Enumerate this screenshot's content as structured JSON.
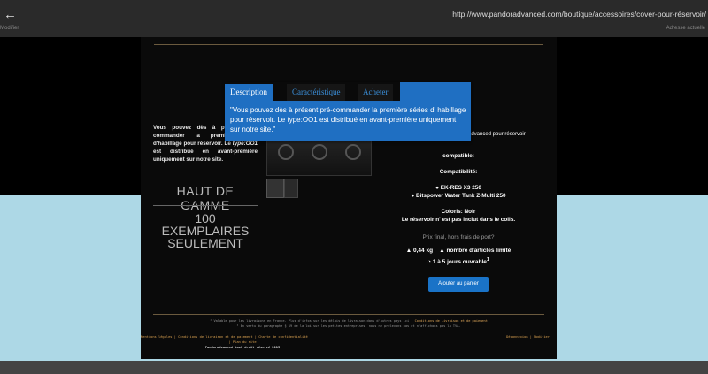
{
  "browser": {
    "back_label": "Modifier",
    "url": "http://www.pandoradvanced.com/boutique/accessoires/cover-pour-réservoir/",
    "address_label": "Adresse actuelle"
  },
  "intro": {
    "text_before": "Vous pouvez dès à présent pré-commander la première série d'habillage pour réservoir. Le ",
    "em": "type:OO1",
    "text_after": " est distribué en avant-première uniquement sur notre site."
  },
  "high_end": "HAUT DE GAMME",
  "limited_l1": "100 EXEMPLAIRES",
  "limited_l2": "SEULEMENT",
  "product": {
    "desc_fragment": "radvanced pour réservoir",
    "compat_fragment": "compatible:",
    "compat_title": "Compatibilité:",
    "compat_items": [
      "EK-RES X3 250",
      "Bitspower Water Tank Z-Multi 250"
    ],
    "colors": "Coloris: Noir",
    "note": "Le réservoir n' est pas inclut dans le colis."
  },
  "price_link": "Prix final, hors frais de port?",
  "weight": "0,44 kg",
  "limit_label": "nombre d'articles limité",
  "delivery": "1 à 5 jours ouvrable",
  "delivery_sup": "1",
  "add_to_cart": "Ajouter au panier",
  "footnote1": {
    "text": "¹ Valable pour les livraisons en France. Plus d'infos sur les délais de livraison dans d'autres pays ici : ",
    "link": "Conditions de livraison et de paiement"
  },
  "footnote2": "² En vertu du paragraphe § 19 de la loi sur les petites entreprises, nous ne prélevons pas et n'affichons pas la TVA.",
  "footer": {
    "links": "Mentions légales | Conditions de livraison et de paiement | Charte de confidentialité",
    "line2": "| Plan du site",
    "right": "Déconnexion | Modifier",
    "copyright": "Pandoradvanced tout droit réservé 2015"
  },
  "popup": {
    "tabs": [
      "Description",
      "Caractéristique",
      "Acheter"
    ],
    "text": "\"Vous pouvez dès à présent pré-commander la première séries d' habillage pour réservoir. Le type:OO1 est distribué en avant-première uniquement sur notre site.\""
  }
}
